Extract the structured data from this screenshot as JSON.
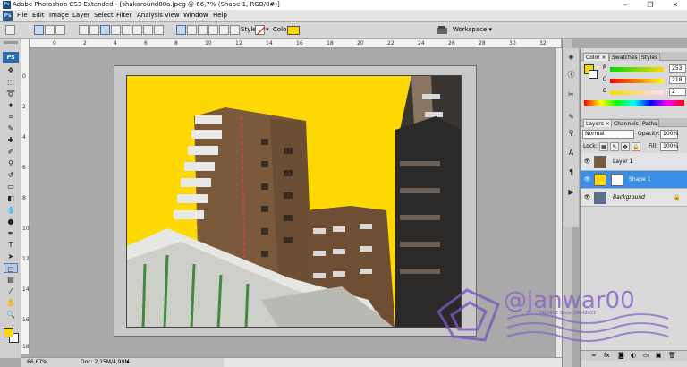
{
  "window": {
    "title": "Adobe Photoshop CS3 Extended - [shakaround80a.jpeg @ 66,7% (Shape 1, RGB/8#)]",
    "minimize": "–",
    "maximize": "❐",
    "close": "✕"
  },
  "menubar": {
    "logo": "Ps",
    "items": [
      "File",
      "Edit",
      "Image",
      "Layer",
      "Select",
      "Filter",
      "Analysis",
      "View",
      "Window",
      "Help"
    ]
  },
  "options": {
    "style_label": "Style:",
    "color_label": "Color:",
    "color_value": "#fdd802",
    "workspace_label": "Workspace ▾"
  },
  "toolbox": {
    "logo": "Ps",
    "foreground_color": "#fdd802",
    "background_color": "#ffffff"
  },
  "ruler": {
    "top_ticks": [
      "0",
      "2",
      "4",
      "6",
      "8",
      "10",
      "12",
      "14",
      "16",
      "18",
      "20",
      "22",
      "24",
      "26",
      "28",
      "30",
      "32"
    ],
    "left_ticks": [
      "0",
      "2",
      "4",
      "6",
      "8",
      "10",
      "12",
      "14",
      "16",
      "18"
    ]
  },
  "document": {
    "file_name": "shakaround80a.jpeg",
    "zoom": "66,67%",
    "doc_size": "Doc: 2,15M/4,99M"
  },
  "color_panel": {
    "tabs": [
      "Color ×",
      "Swatches",
      "Styles"
    ],
    "r_label": "R",
    "g_label": "G",
    "b_label": "B",
    "r": "253",
    "g": "218",
    "b": "2"
  },
  "layers_panel": {
    "tabs": [
      "Layers ×",
      "Channels",
      "Paths"
    ],
    "blend_mode": "Normal",
    "opacity_label": "Opacity:",
    "opacity": "100%",
    "lock_label": "Lock:",
    "fill_label": "Fill:",
    "fill": "100%",
    "layers": [
      {
        "name": "Layer 1",
        "selected": false
      },
      {
        "name": "Shape 1",
        "selected": true
      },
      {
        "name": "Background",
        "selected": false
      }
    ]
  },
  "watermark": {
    "handle": "@janwar00",
    "sub": "ON HIVE Since 29042021"
  }
}
